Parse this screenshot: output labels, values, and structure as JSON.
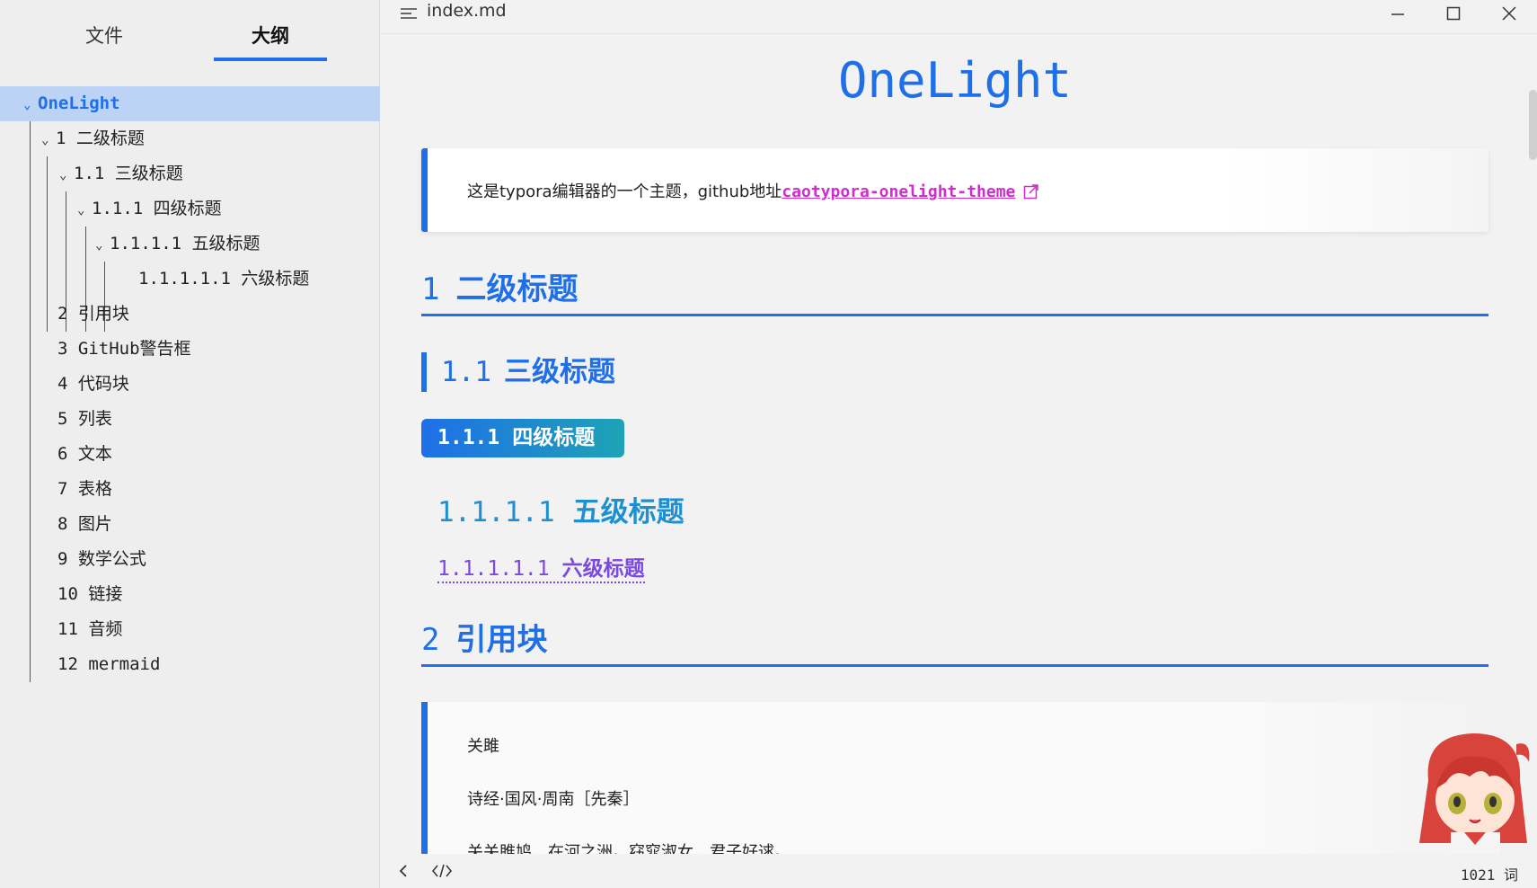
{
  "sidebar": {
    "tabs": {
      "files": "文件",
      "outline": "大纲"
    },
    "outline": [
      {
        "label": "OneLight",
        "level": 0,
        "expanded": true,
        "active": true
      },
      {
        "label": "1  二级标题",
        "level": 1,
        "expanded": true
      },
      {
        "label": "1.1  三级标题",
        "level": 2,
        "expanded": true
      },
      {
        "label": "1.1.1  四级标题",
        "level": 3,
        "expanded": true
      },
      {
        "label": "1.1.1.1  五级标题",
        "level": 4,
        "expanded": true
      },
      {
        "label": "1.1.1.1.1  六级标题",
        "level": 5
      },
      {
        "label": "2  引用块",
        "level": 1
      },
      {
        "label": "3  GitHub警告框",
        "level": 1
      },
      {
        "label": "4  代码块",
        "level": 1
      },
      {
        "label": "5  列表",
        "level": 1
      },
      {
        "label": "6  文本",
        "level": 1
      },
      {
        "label": "7  表格",
        "level": 1
      },
      {
        "label": "8  图片",
        "level": 1
      },
      {
        "label": "9  数学公式",
        "level": 1
      },
      {
        "label": "10  链接",
        "level": 1
      },
      {
        "label": "11  音频",
        "level": 1
      },
      {
        "label": "12  mermaid",
        "level": 1
      }
    ]
  },
  "titlebar": {
    "filename": "index.md"
  },
  "doc": {
    "title": "OneLight",
    "intro_text": "这是typora编辑器的一个主题，github地址",
    "intro_link": "caotypora-onelight-theme",
    "h2_1": {
      "num": "1",
      "text": "二级标题"
    },
    "h3": {
      "num": "1.1",
      "text": "三级标题"
    },
    "h4": {
      "num": "1.1.1",
      "text": "四级标题"
    },
    "h5": {
      "num": "1.1.1.1",
      "text": "五级标题"
    },
    "h6": {
      "num": "1.1.1.1.1",
      "text": "六级标题"
    },
    "h2_2": {
      "num": "2",
      "text": "引用块"
    },
    "quote_lines": [
      "关雎",
      "诗经·国风·周南［先秦］",
      "关关雎鸠，在河之洲。窈窕淑女，君子好逑。"
    ]
  },
  "footer": {
    "word_count": "1021 词"
  },
  "colors": {
    "accent": "#1e6fe8",
    "link": "#d22ccf",
    "h5": "#1e8fd0",
    "h6": "#7b48e0"
  }
}
